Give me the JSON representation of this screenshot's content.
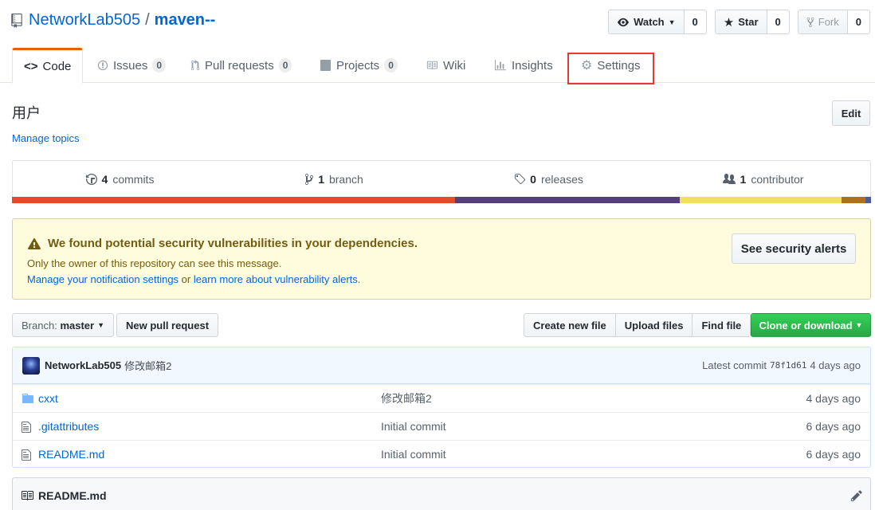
{
  "repo": {
    "owner": "NetworkLab505",
    "separator": "/",
    "name": "maven--"
  },
  "actions": {
    "watch": {
      "label": "Watch",
      "count": "0"
    },
    "star": {
      "label": "Star",
      "count": "0"
    },
    "fork": {
      "label": "Fork",
      "count": "0"
    }
  },
  "tabs": [
    {
      "label": "Code",
      "count": null
    },
    {
      "label": "Issues",
      "count": "0"
    },
    {
      "label": "Pull requests",
      "count": "0"
    },
    {
      "label": "Projects",
      "count": "0"
    },
    {
      "label": "Wiki",
      "count": null
    },
    {
      "label": "Insights",
      "count": null
    },
    {
      "label": "Settings",
      "count": null
    }
  ],
  "description": "用户",
  "manage_topics": "Manage topics",
  "edit_label": "Edit",
  "summary": {
    "commits": {
      "num": "4",
      "label": "commits"
    },
    "branch": {
      "num": "1",
      "label": "branch"
    },
    "releases": {
      "num": "0",
      "label": "releases"
    },
    "contributors": {
      "num": "1",
      "label": "contributor"
    }
  },
  "languages": [
    {
      "color": "#e34c26",
      "share": 51.6
    },
    {
      "color": "#563d7c",
      "share": 26.1
    },
    {
      "color": "#f1e05a",
      "share": 18.9
    },
    {
      "color": "#b07219",
      "share": 2.8
    },
    {
      "color": "#4f5d95",
      "share": 0.6
    }
  ],
  "alert": {
    "title": "We found potential security vulnerabilities in your dependencies.",
    "line1": "Only the owner of this repository can see this message.",
    "link1": "Manage your notification settings",
    "or": " or ",
    "link2": "learn more about vulnerability alerts",
    "period": ".",
    "button": "See security alerts"
  },
  "file_nav": {
    "branch_label": "Branch:",
    "branch_name": "master",
    "new_pr": "New pull request",
    "create_file": "Create new file",
    "upload_files": "Upload files",
    "find_file": "Find file",
    "clone": "Clone or download"
  },
  "commit_tease": {
    "author": "NetworkLab505",
    "message": "修改邮箱2",
    "latest_label": "Latest commit",
    "sha": "78f1d61",
    "age": "4 days ago"
  },
  "files": [
    {
      "type": "dir",
      "name": "cxxt",
      "message": "修改邮箱2",
      "age": "4 days ago"
    },
    {
      "type": "file",
      "name": ".gitattributes",
      "message": "Initial commit",
      "age": "6 days ago"
    },
    {
      "type": "file",
      "name": "README.md",
      "message": "Initial commit",
      "age": "6 days ago"
    }
  ],
  "readme": {
    "title": "README.md"
  },
  "colors": {
    "accent_tab": "#e36209",
    "link": "#0366d6",
    "highlight": "#e53935",
    "clone_green": "#28a745"
  }
}
